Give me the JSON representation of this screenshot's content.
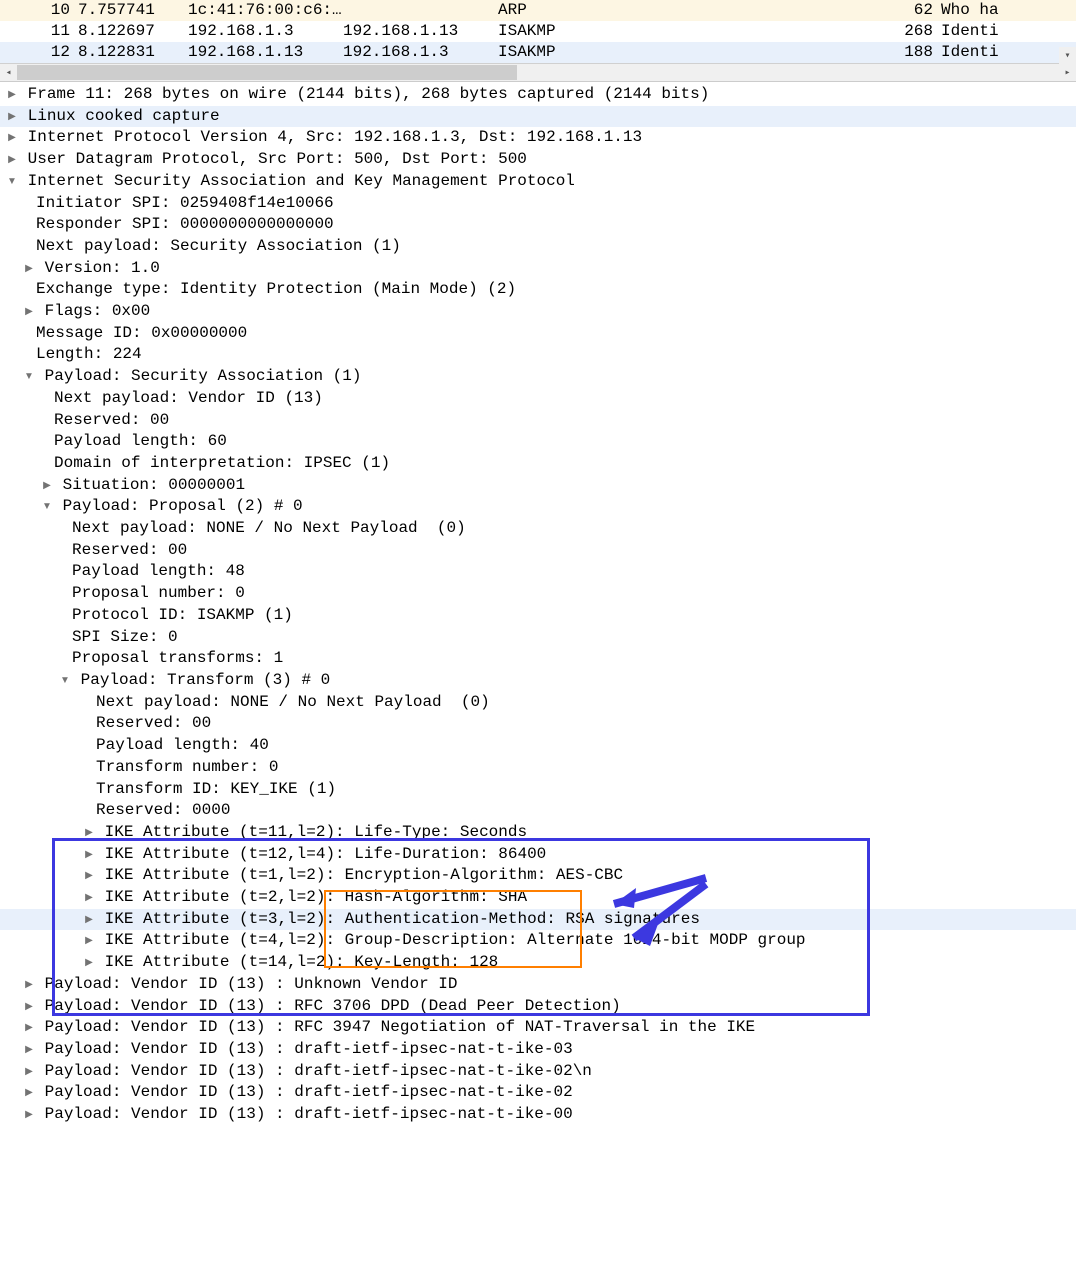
{
  "packets": [
    {
      "no": "10",
      "time": "7.757741",
      "src": "1c:41:76:00:c6:…",
      "dst": "",
      "proto": "ARP",
      "len": "62",
      "info": "Who ha",
      "sel": true
    },
    {
      "no": "11",
      "time": "8.122697",
      "src": "192.168.1.3",
      "dst": "192.168.1.13",
      "proto": "ISAKMP",
      "len": "268",
      "info": "Identi",
      "sel": false
    },
    {
      "no": "12",
      "time": "8.122831",
      "src": "192.168.1.13",
      "dst": "192.168.1.3",
      "proto": "ISAKMP",
      "len": "188",
      "info": "Identi",
      "sel": false,
      "alt": true
    }
  ],
  "tree": {
    "frame": "Frame 11: 268 bytes on wire (2144 bits), 268 bytes captured (2144 bits)",
    "cooked": "Linux cooked capture",
    "ip": "Internet Protocol Version 4, Src: 192.168.1.3, Dst: 192.168.1.13",
    "udp": "User Datagram Protocol, Src Port: 500, Dst Port: 500",
    "isakmp": "Internet Security Association and Key Management Protocol",
    "ispi": "Initiator SPI: 0259408f14e10066",
    "rspi": "Responder SPI: 0000000000000000",
    "nextp": "Next payload: Security Association (1)",
    "ver": "Version: 1.0",
    "exch": "Exchange type: Identity Protection (Main Mode) (2)",
    "flags": "Flags: 0x00",
    "mid": "Message ID: 0x00000000",
    "len": "Length: 224",
    "sa": "Payload: Security Association (1)",
    "sa_np": "Next payload: Vendor ID (13)",
    "sa_res": "Reserved: 00",
    "sa_plen": "Payload length: 60",
    "sa_doi": "Domain of interpretation: IPSEC (1)",
    "sa_sit": "Situation: 00000001",
    "prop": "Payload: Proposal (2) # 0",
    "prop_np": "Next payload: NONE / No Next Payload  (0)",
    "prop_res": "Reserved: 00",
    "prop_plen": "Payload length: 48",
    "prop_num": "Proposal number: 0",
    "prop_pid": "Protocol ID: ISAKMP (1)",
    "prop_spi": "SPI Size: 0",
    "prop_xf": "Proposal transforms: 1",
    "xform": "Payload: Transform (3) # 0",
    "xform_np": "Next payload: NONE / No Next Payload  (0)",
    "xform_res": "Reserved: 00",
    "xform_plen": "Payload length: 40",
    "xform_num": "Transform number: 0",
    "xform_id": "Transform ID: KEY_IKE (1)",
    "xform_r2": "Reserved: 0000",
    "attr1a": "IKE Attribute (t=11,l=2): ",
    "attr1b": "Life-Type: Seconds",
    "attr2a": "IKE Attribute (t=12,l=4): ",
    "attr2b": "Life-Duration: 86400",
    "attr3a": "IKE Attribute (t=1,l=2): ",
    "attr3b": "Encryption-Algorithm: AES-CBC",
    "attr4a": "IKE Attribute (t=2,l=2): ",
    "attr4b": "Hash-Algorithm: SHA",
    "attr5a": "IKE Attribute (t=3,l=2): ",
    "attr5b": "Authentication-Method: RSA signatures",
    "attr6a": "IKE Attribute (t=4,l=2): ",
    "attr6b": "Group-Description: Alternate 1024-bit MODP group",
    "attr7a": "IKE Attribute (t=14,l=2): ",
    "attr7b": "Key-Length: 128",
    "vids": [
      "Payload: Vendor ID (13) : Unknown Vendor ID",
      "Payload: Vendor ID (13) : RFC 3706 DPD (Dead Peer Detection)",
      "Payload: Vendor ID (13) : RFC 3947 Negotiation of NAT-Traversal in the IKE",
      "Payload: Vendor ID (13) : draft-ietf-ipsec-nat-t-ike-03",
      "Payload: Vendor ID (13) : draft-ietf-ipsec-nat-t-ike-02\\n",
      "Payload: Vendor ID (13) : draft-ietf-ipsec-nat-t-ike-02",
      "Payload: Vendor ID (13) : draft-ietf-ipsec-nat-t-ike-00"
    ]
  }
}
